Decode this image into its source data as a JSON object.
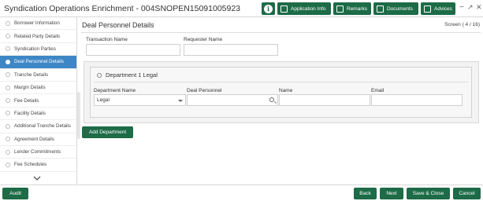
{
  "header": {
    "title": "Syndication Operations Enrichment - 004SNOPEN15091005923",
    "buttons": {
      "application_info": "Application Info",
      "remarks": "Remarks",
      "documents": "Documents",
      "advices": "Advices"
    },
    "window_controls": {
      "minimize": "−",
      "maximize": "↗",
      "close": "✕"
    }
  },
  "sidebar": {
    "items": [
      {
        "label": "Borrower Information"
      },
      {
        "label": "Related Party Details"
      },
      {
        "label": "Syndication Parties"
      },
      {
        "label": "Deal Personnel Details",
        "active": true
      },
      {
        "label": "Tranche Details"
      },
      {
        "label": "Margin Details"
      },
      {
        "label": "Fee Details"
      },
      {
        "label": "Facility Details"
      },
      {
        "label": "Additional Tranche Details"
      },
      {
        "label": "Agreement Details"
      },
      {
        "label": "Lender Commitments"
      },
      {
        "label": "Fee Schedules"
      }
    ],
    "more_icon": "chevron-down-icon"
  },
  "main": {
    "page_title": "Deal Personnel Details",
    "screen_indicator": "Screen ( 4 / 16)",
    "fields": {
      "transaction_name": {
        "label": "Transaction Name",
        "value": ""
      },
      "requester_name": {
        "label": "Requester Name",
        "value": ""
      }
    },
    "department": {
      "header": "Department 1 Legal",
      "columns": {
        "department_name": "Department Name",
        "deal_personnel": "Deal Personnel",
        "name": "Name",
        "email": "Email"
      },
      "values": {
        "department_name": "Legal",
        "deal_personnel": "",
        "name": "",
        "email": ""
      }
    },
    "add_department": "Add Department"
  },
  "footer": {
    "audit": "Audit",
    "back": "Back",
    "next": "Next",
    "save_close": "Save & Close",
    "cancel": "Cancel"
  },
  "colors": {
    "primary_button": "#1d6b47",
    "sidebar_active": "#3e87c6"
  }
}
